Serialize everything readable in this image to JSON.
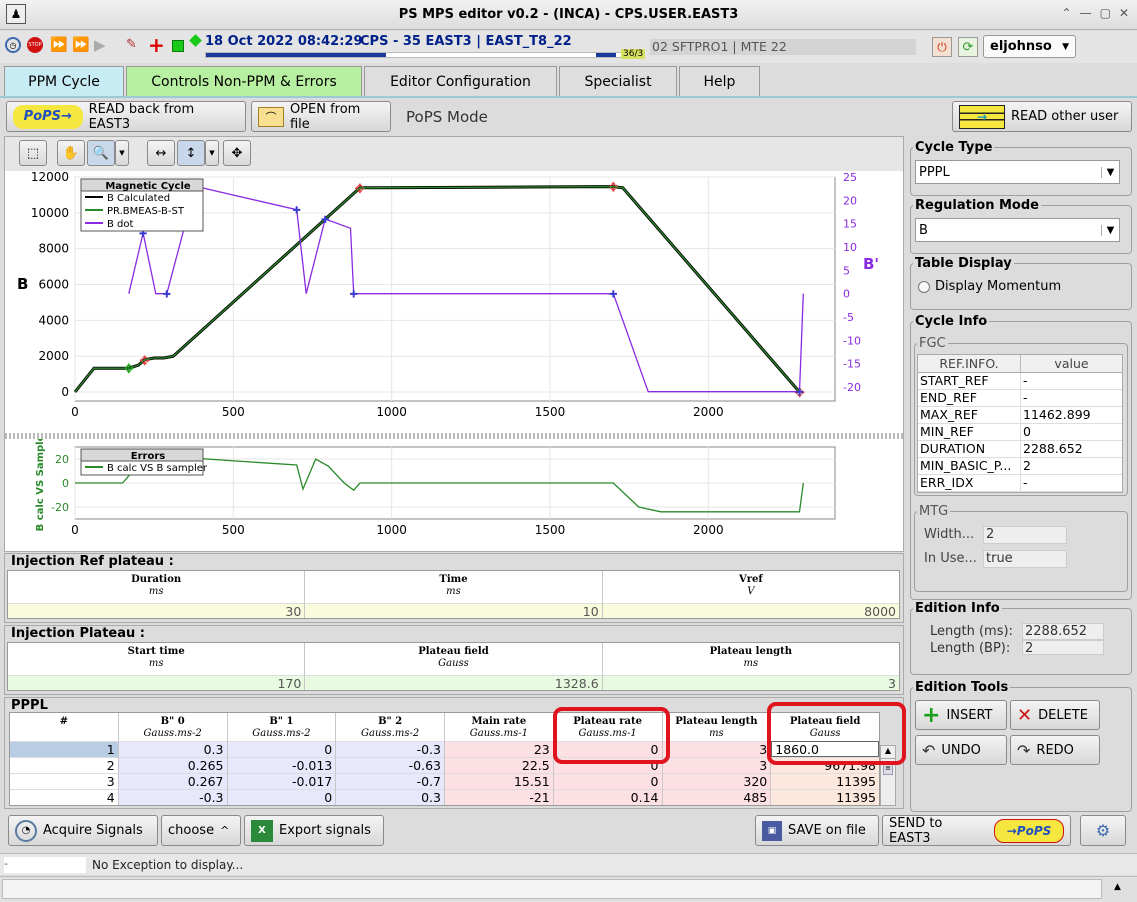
{
  "window": {
    "title": "PS MPS editor v0.2 - (INCA)  - CPS.USER.EAST3"
  },
  "toolbar": {
    "datetime": "18 Oct 2022  08:42:29",
    "cycle": "CPS - 35 EAST3 | EAST_T8_22",
    "counter": "36/3",
    "cycle2": "02 SFTPRO1 | MTE  22",
    "user": "eljohnso"
  },
  "tabs": [
    "PPM Cycle",
    "Controls Non-PPM & Errors",
    "Editor Configuration",
    "Specialist",
    "Help"
  ],
  "actions": {
    "read_back": "READ back from EAST3",
    "open_file": "OPEN from file",
    "mode": "PoPS Mode",
    "read_other": "READ other user"
  },
  "chart_data": [
    {
      "type": "line",
      "title": "Magnetic Cycle",
      "ylabel": "B",
      "y2label": "B'",
      "xlim": [
        0,
        2400
      ],
      "ylim": [
        -500,
        12000
      ],
      "y2lim": [
        -23,
        25
      ],
      "xticks": [
        0,
        500,
        1000,
        1500,
        2000
      ],
      "yticks": [
        0,
        2000,
        4000,
        6000,
        8000,
        10000,
        12000
      ],
      "y2ticks": [
        -20,
        -15,
        -10,
        -5,
        0,
        5,
        10,
        15,
        20,
        25
      ],
      "series": [
        {
          "name": "B Calculated",
          "color": "#000000",
          "x": [
            0,
            60,
            170,
            200,
            220,
            250,
            280,
            310,
            900,
            1500,
            1700,
            1730,
            2288
          ],
          "y": [
            0,
            1330,
            1330,
            1500,
            1800,
            1900,
            1900,
            2000,
            11395,
            11450,
            11462,
            11395,
            0
          ]
        },
        {
          "name": "PR.BMEAS-B-ST",
          "color": "#2a8a2a",
          "x": [
            0,
            60,
            170,
            200,
            220,
            250,
            280,
            310,
            900,
            1500,
            1700,
            1730,
            2288
          ],
          "y": [
            0,
            1330,
            1330,
            1500,
            1800,
            1900,
            1900,
            2000,
            11395,
            11450,
            11462,
            11395,
            0
          ]
        },
        {
          "name": "B dot",
          "axis": "y2",
          "color": "#8a2be2",
          "x": [
            170,
            215,
            255,
            290,
            380,
            700,
            730,
            790,
            870,
            880,
            1200,
            1700,
            1810,
            2288,
            2300
          ],
          "y": [
            0,
            13,
            0,
            0,
            23,
            18,
            0,
            16,
            14,
            0,
            0,
            0,
            -21,
            -21,
            0
          ]
        }
      ]
    },
    {
      "type": "line",
      "title": "Errors",
      "ylabel": "B calc VS Sample",
      "xlim": [
        0,
        2400
      ],
      "ylim": [
        -30,
        30
      ],
      "xticks": [
        0,
        500,
        1000,
        1500,
        2000
      ],
      "yticks": [
        -20,
        0,
        20
      ],
      "series": [
        {
          "name": "B calc VS B sampler",
          "color": "#2a8a2a",
          "x": [
            0,
            150,
            200,
            230,
            270,
            300,
            700,
            720,
            760,
            800,
            850,
            880,
            900,
            1200,
            1700,
            1780,
            1850,
            2288,
            2300
          ],
          "y": [
            0,
            0,
            15,
            8,
            15,
            22,
            15,
            -5,
            20,
            14,
            0,
            -6,
            0,
            0,
            0,
            -20,
            -24,
            -24,
            0
          ]
        }
      ]
    }
  ],
  "injection_ref": {
    "title": "Injection Ref plateau :",
    "headers": [
      {
        "n": "Duration",
        "u": "ms"
      },
      {
        "n": "Time",
        "u": "ms"
      },
      {
        "n": "Vref",
        "u": "V"
      }
    ],
    "values": [
      "30",
      "10",
      "8000"
    ]
  },
  "injection_plateau": {
    "title": "Injection Plateau :",
    "headers": [
      {
        "n": "Start time",
        "u": "ms"
      },
      {
        "n": "Plateau field",
        "u": "Gauss"
      },
      {
        "n": "Plateau length",
        "u": "ms"
      }
    ],
    "values": [
      "170",
      "1328.6",
      "3"
    ]
  },
  "pppl": {
    "title": "PPPL",
    "headers": [
      {
        "n": "#",
        "u": ""
      },
      {
        "n": "B\" 0",
        "u": "Gauss.ms-2"
      },
      {
        "n": "B\" 1",
        "u": "Gauss.ms-2"
      },
      {
        "n": "B\" 2",
        "u": "Gauss.ms-2"
      },
      {
        "n": "Main rate",
        "u": "Gauss.ms-1"
      },
      {
        "n": "Plateau rate",
        "u": "Gauss.ms-1"
      },
      {
        "n": "Plateau length",
        "u": "ms"
      },
      {
        "n": "Plateau field",
        "u": "Gauss"
      }
    ],
    "rows": [
      [
        "1",
        "0.3",
        "0",
        "-0.3",
        "23",
        "0",
        "3",
        "1860.0"
      ],
      [
        "2",
        "0.265",
        "-0.013",
        "-0.63",
        "22.5",
        "0",
        "3",
        "9671.98"
      ],
      [
        "3",
        "0.267",
        "-0.017",
        "-0.7",
        "15.51",
        "0",
        "320",
        "11395"
      ],
      [
        "4",
        "-0.3",
        "0",
        "0.3",
        "-21",
        "0.14",
        "485",
        "11395"
      ]
    ]
  },
  "right": {
    "cycle_type_label": "Cycle Type",
    "cycle_type": "PPPL",
    "reg_mode_label": "Regulation Mode",
    "reg_mode": "B",
    "table_display_label": "Table Display",
    "display_momentum": "Display Momentum",
    "cycle_info_label": "Cycle Info",
    "fgc_label": "FGC",
    "fgc_head": [
      "REF.INFO.",
      "value"
    ],
    "fgc_rows": [
      [
        "START_REF",
        "-"
      ],
      [
        "END_REF",
        "-"
      ],
      [
        "MAX_REF",
        "11462.899"
      ],
      [
        "MIN_REF",
        "0"
      ],
      [
        "DURATION",
        "2288.652"
      ],
      [
        "MIN_BASIC_P...",
        "2"
      ],
      [
        "ERR_IDX",
        "-"
      ]
    ],
    "mtg_label": "MTG",
    "width_label": "Width...",
    "width_val": "2",
    "inuse_label": "In Use...",
    "inuse_val": "true",
    "edition_info_label": "Edition Info",
    "length_ms_label": "Length (ms):",
    "length_ms": "2288.652",
    "length_bp_label": "Length (BP):",
    "length_bp": "2",
    "edition_tools_label": "Edition Tools",
    "insert": "INSERT",
    "delete": "DELETE",
    "undo": "UNDO",
    "redo": "REDO"
  },
  "bottom": {
    "acquire": "Acquire Signals",
    "choose": "choose",
    "export": "Export signals",
    "save": "SAVE on file",
    "send": "SEND to EAST3"
  },
  "status": {
    "dash": "-",
    "message": "No Exception to display..."
  }
}
